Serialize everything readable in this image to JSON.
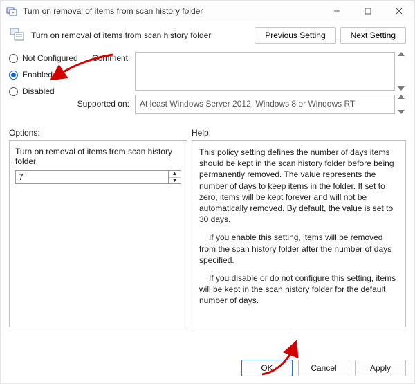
{
  "window": {
    "title": "Turn on removal of items from scan history folder"
  },
  "header": {
    "policy_title": "Turn on removal of items from scan history folder",
    "previous_setting": "Previous Setting",
    "next_setting": "Next Setting"
  },
  "state": {
    "not_configured": "Not Configured",
    "enabled": "Enabled",
    "disabled": "Disabled",
    "selected": "enabled"
  },
  "comment": {
    "label": "Comment:",
    "value": ""
  },
  "supported": {
    "label": "Supported on:",
    "value": "At least Windows Server 2012, Windows 8 or Windows RT"
  },
  "options": {
    "label": "Options:",
    "item_label": "Turn on removal of items from scan history folder",
    "value": "7"
  },
  "help": {
    "label": "Help:",
    "p1": "This policy setting defines the number of days items should be kept in the scan history folder before being permanently removed. The value represents the number of days to keep items in the folder. If set to zero, items will be kept forever and will not be automatically removed. By default, the value is set to 30 days.",
    "p2": "If you enable this setting, items will be removed from the scan history folder after the number of days specified.",
    "p3": "If you disable or do not configure this setting, items will be kept in the scan history folder for the default number of days."
  },
  "buttons": {
    "ok": "OK",
    "cancel": "Cancel",
    "apply": "Apply"
  }
}
